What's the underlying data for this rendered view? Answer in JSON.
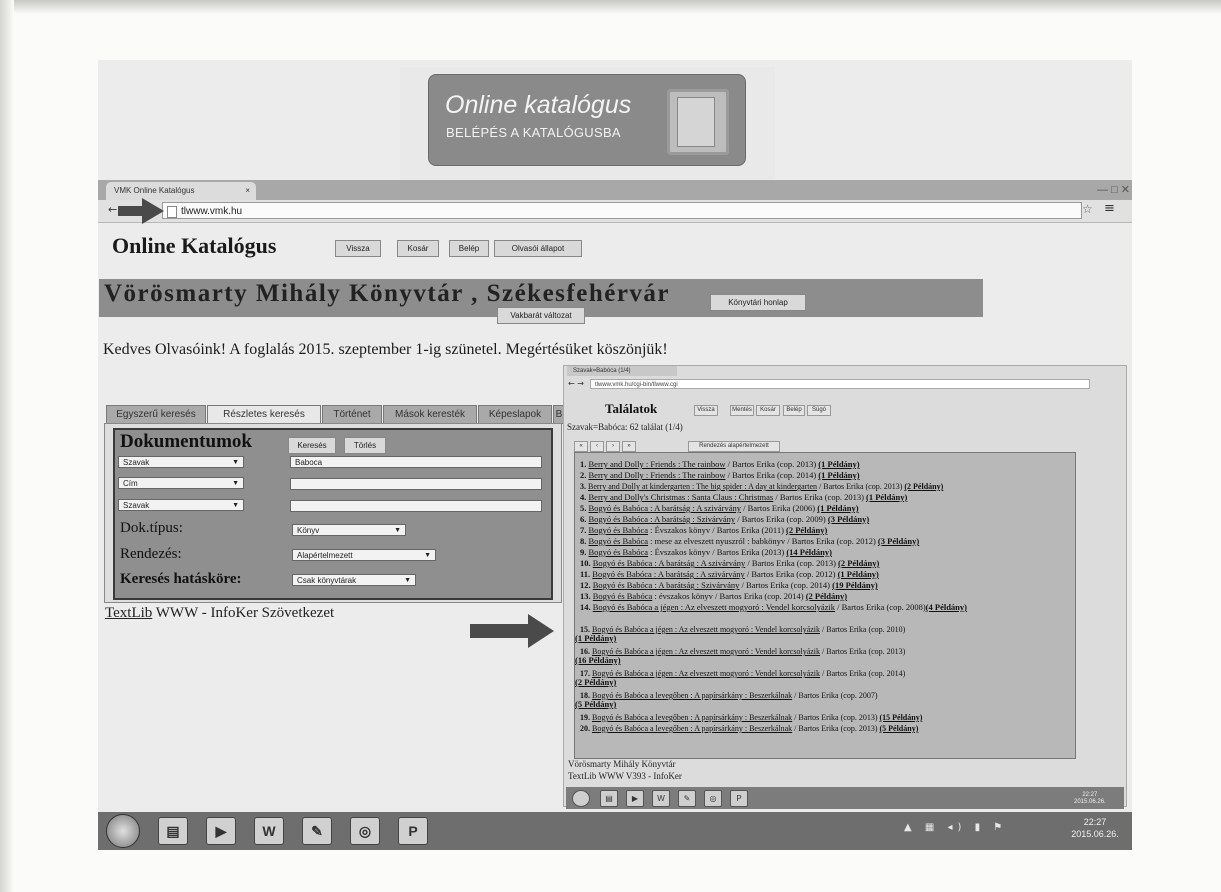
{
  "banner": {
    "title": "Online katalógus",
    "subtitle": "BELÉPÉS A KATALÓGUSBA"
  },
  "browser": {
    "tab_title": "VMK Online Katalógus",
    "tab_close": "×",
    "url": "tlwww.vmk.hu",
    "window_controls": "— □ ✕"
  },
  "page": {
    "heading": "Online Katalógus",
    "buttons": [
      "Vissza",
      "Kosár",
      "Belép",
      "Olvasói állapot"
    ],
    "library_title": "Vörösmarty Mihály Könyvtár , Székesfehérvár",
    "homepage_button": "Könyvtári honlap",
    "accessible_button": "Vakbarát változat",
    "notice": "Kedves Olvasóink! A foglalás 2015. szeptember 1-ig szünetel. Megértésüket köszönjük!"
  },
  "search_tabs": [
    "Egyszerű keresés",
    "Részletes keresés",
    "Történet",
    "Mások keresték",
    "Képeslapok",
    "B"
  ],
  "form": {
    "title": "Dokumentumok",
    "search_button": "Keresés",
    "clear_button": "Törlés",
    "fields": [
      {
        "select": "Szavak",
        "value": "Baboca"
      },
      {
        "select": "Cím",
        "value": ""
      },
      {
        "select": "Szavak",
        "value": ""
      }
    ],
    "doktipus_label": "Dok.típus:",
    "doktipus_value": "Könyv",
    "rendezes_label": "Rendezés:",
    "rendezes_value": "Alapértelmezett",
    "hatasköre_label": "Keresés hatásköre:",
    "hatasköre_value": "Csak könyvtárak"
  },
  "footer": {
    "link": "TextLib",
    "rest": " WWW - InfoKer Szövetkezet"
  },
  "results_window": {
    "tab_title": "Szavak=Babóca (1/4)",
    "url": "tlwww.vmk.hu/cgi-bin/tlwww.cgi",
    "heading": "Találatok",
    "buttons": [
      "Vissza",
      "Mentés",
      "Kosár",
      "Belép",
      "Súgó"
    ],
    "query": "Szavak=Babóca: 62 találat (1/4)",
    "sort_select": "Rendezés alapértelmezett",
    "rows": [
      {
        "n": "1.",
        "link": "Berry and Dolly : Friends : The rainbow",
        "rest": " / Bartos Erika (cop. 2013) ",
        "copies": "(1 Példány)"
      },
      {
        "n": "2.",
        "link": "Berry and Dolly : Friends : The rainbow",
        "rest": " / Bartos Erika (cop. 2014) ",
        "copies": "(1 Példány)"
      },
      {
        "n": "3.",
        "link": "Berry and Dolly at kindergarten : The big spider : A day at kindergarten",
        "rest": " / Bartos Erika (cop. 2013) ",
        "copies": "(2 Példány)"
      },
      {
        "n": "4.",
        "link": "Berry and Dolly's Christmas : Santa Claus : Christmas",
        "rest": " / Bartos Erika (cop. 2013) ",
        "copies": "(1 Példány)"
      },
      {
        "n": "5.",
        "link": "Bogyó és Babóca : A barátság : A szivárvány",
        "rest": " / Bartos Erika (2006) ",
        "copies": "(1 Példány)"
      },
      {
        "n": "6.",
        "link": "Bogyó és Babóca : A barátság : Szivárvány",
        "rest": " / Bartos Erika (cop. 2009) ",
        "copies": "(3 Példány)"
      },
      {
        "n": "7.",
        "link": "Bogyó és Babóca",
        "rest": " : Évszakos könyv / Bartos Erika (2011) ",
        "copies": "(2 Példány)"
      },
      {
        "n": "8.",
        "link": "Bogyó és Babóca",
        "rest": " : mese az elveszett nyuszról : babkönyv / Bartos Erika (cop. 2012) ",
        "copies": "(3 Példány)"
      },
      {
        "n": "9.",
        "link": "Bogyó és Babóca",
        "rest": " : Évszakos könyv / Bartos Erika (2013) ",
        "copies": "(14 Példány)"
      },
      {
        "n": "10.",
        "link": "Bogyó és Babóca : A barátság : A szivárvány",
        "rest": " / Bartos Erika (cop. 2013) ",
        "copies": "(2 Példány)"
      },
      {
        "n": "11.",
        "link": "Bogyó és Babóca : A barátság : A szivárvány",
        "rest": " / Bartos Erika (cop. 2012) ",
        "copies": "(1 Példány)"
      },
      {
        "n": "12.",
        "link": "Bogyó és Babóca : A barátság : Szivárvány",
        "rest": " / Bartos Erika (cop. 2014) ",
        "copies": "(19 Példány)"
      },
      {
        "n": "13.",
        "link": "Bogyó és Babóca",
        "rest": " : évszakos könyv / Bartos Erika (cop. 2014) ",
        "copies": "(2 Példány)"
      },
      {
        "n": "14.",
        "link": "Bogyó és Babóca a jégen : Az elveszett mogyoró : Vendel korcsolyázik",
        "rest": " / Bartos Erika (cop. 2008)",
        "copies": "(4 Példány)"
      },
      {
        "n": "15.",
        "link": "Bogyó és Babóca a jégen : Az elveszett mogyoró : Vendel korcsolyázik",
        "rest": " / Bartos Erika (cop. 2010)",
        "copies": "(1 Példány)"
      },
      {
        "n": "16.",
        "link": "Bogyó és Babóca a jégen : Az elveszett mogyoró : Vendel korcsolyázik",
        "rest": " / Bartos Erika (cop. 2013)",
        "copies": "(16 Példány)"
      },
      {
        "n": "17.",
        "link": "Bogyó és Babóca a jégen : Az elveszett mogyoró : Vendel korcsolyázik",
        "rest": " / Bartos Erika (cop. 2014)",
        "copies": "(2 Példány)"
      },
      {
        "n": "18.",
        "link": "Bogyó és Babóca a levegőben : A papírsárkány : Beszerkálnak",
        "rest": " / Bartos Erika (cop. 2007) ",
        "copies": "(5 Példány)"
      },
      {
        "n": "19.",
        "link": "Bogyó és Babóca a levegőben : A papírsárkány : Beszerkálnak",
        "rest": " / Bartos Erika (cop. 2013) ",
        "copies": "(15 Példány)"
      },
      {
        "n": "20.",
        "link": "Bogyó és Babóca a levegőben : A papírsárkány : Beszerkálnak",
        "rest": " / Bartos Erika (cop. 2013) ",
        "copies": "(5 Példány)"
      }
    ],
    "footer_line1": "Vörösmarty Mihály Könyvtár",
    "footer_line2": "TextLib WWW V393 - InfoKer",
    "clock_time": "22:27",
    "clock_date": "2015.06.26."
  },
  "taskbar": {
    "clock_time": "22:27",
    "clock_date": "2015.06.26.",
    "icons": [
      "explorer-icon",
      "media-player-icon",
      "word-icon",
      "paint-icon",
      "chrome-icon",
      "publisher-icon"
    ],
    "icon_glyphs": [
      "▤",
      "▶",
      "W",
      "✎",
      "◎",
      "P"
    ],
    "tray_glyphs": "▲ ▦ ◂) ▮ ⚑"
  }
}
